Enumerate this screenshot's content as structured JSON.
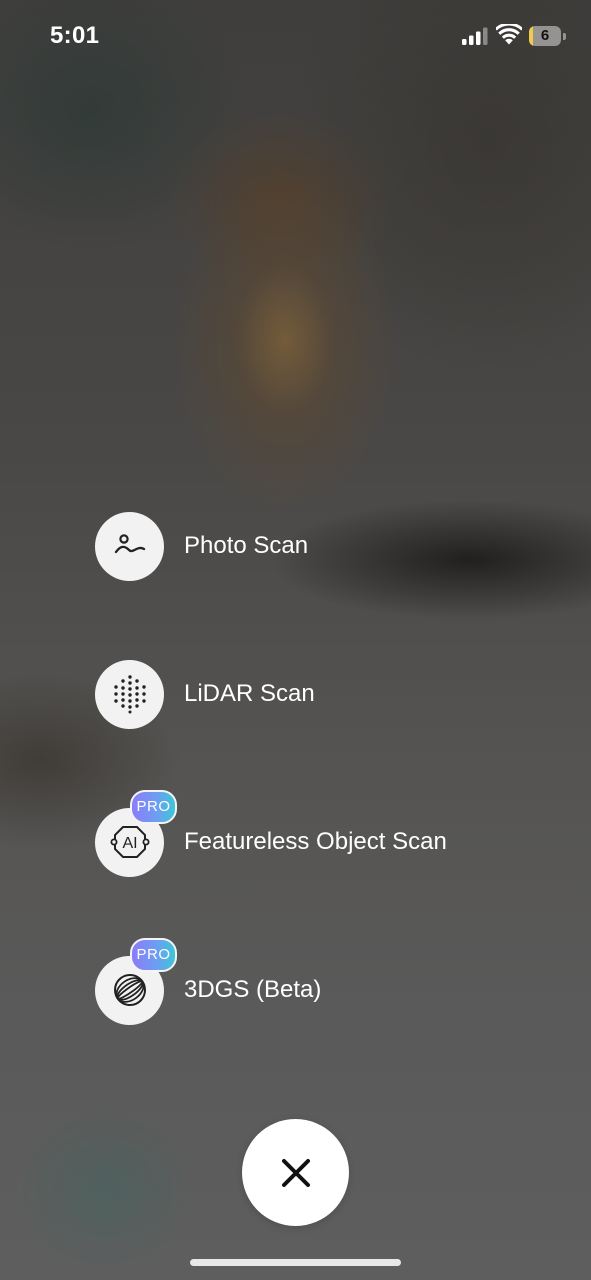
{
  "status_bar": {
    "time": "5:01",
    "battery_level": "6",
    "battery_fraction": 0.06,
    "icons": [
      "cellular-signal-icon",
      "wifi-icon",
      "battery-icon"
    ]
  },
  "menu": {
    "items": [
      {
        "label": "Photo Scan",
        "icon": "photo-landscape-icon",
        "pro": false
      },
      {
        "label": "LiDAR Scan",
        "icon": "point-cloud-dots-icon",
        "pro": false
      },
      {
        "label": "Featureless Object Scan",
        "icon": "ai-chip-icon",
        "pro": true,
        "badge": "PRO"
      },
      {
        "label": "3DGS (Beta)",
        "icon": "gaussian-sphere-icon",
        "pro": true,
        "badge": "PRO"
      }
    ]
  },
  "close_button": {
    "icon": "close-x-icon"
  },
  "colors": {
    "badge_gradient": [
      "#8b7cf8",
      "#6f9cf3",
      "#3dc6d8"
    ],
    "battery_fill": "#f2c94c",
    "icon_circle": "#f2f2f2"
  }
}
